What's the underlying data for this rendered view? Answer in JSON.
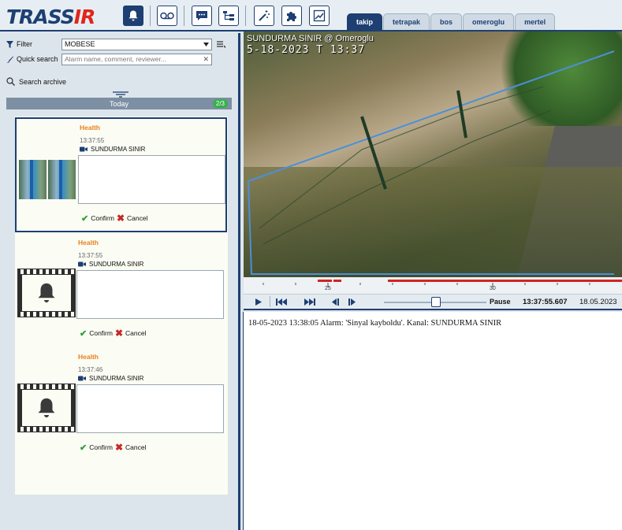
{
  "app": {
    "logo_main": "TRASS",
    "logo_accent": "IR"
  },
  "toolbar": {
    "tools": [
      "bell-icon",
      "voicemail-icon",
      "chat-icon",
      "tree-icon",
      "magic-wand-icon",
      "puzzle-icon",
      "chart-edit-icon"
    ]
  },
  "tabs": [
    {
      "label": "takip",
      "active": true
    },
    {
      "label": "tetrapak",
      "active": false
    },
    {
      "label": "bos",
      "active": false
    },
    {
      "label": "omeroglu",
      "active": false
    },
    {
      "label": "mertel",
      "active": false
    }
  ],
  "left": {
    "filter_label": "Filter",
    "filter_value": "MOBESE",
    "quick_search_label": "Quick search",
    "quick_search_placeholder": "Alarm name, comment, reviewer...",
    "search_archive_label": "Search archive",
    "today_label": "Today",
    "today_count": "2/3"
  },
  "alarms": [
    {
      "type": "Health",
      "time": "13:37:55",
      "channel": "SUNDURMA SINIR",
      "confirm": "Confirm",
      "cancel": "Cancel",
      "thumbnail": "camera-snapshot"
    },
    {
      "type": "Health",
      "time": "13:37:55",
      "channel": "SUNDURMA SINIR",
      "confirm": "Confirm",
      "cancel": "Cancel",
      "thumbnail": "bell-film-icon"
    },
    {
      "type": "Health",
      "time": "13:37:46",
      "channel": "SUNDURMA SINIR",
      "confirm": "Confirm",
      "cancel": "Cancel",
      "thumbnail": "bell-film-icon"
    }
  ],
  "video": {
    "osd_title": "SUNDURMA SINIR @ Omeroglu",
    "osd_time": "5-18-2023 T   13:37"
  },
  "timeline": {
    "tick_labels": [
      "25",
      "30"
    ]
  },
  "player": {
    "state": "Pause",
    "time": "13:37:55.607",
    "date": "18.05.2023"
  },
  "log": {
    "lines": [
      "18-05-2023 13:38:05 Alarm: 'Sinyal kayboldu'. Kanal: SUNDURMA SINIR"
    ]
  },
  "colors": {
    "brand_navy": "#1d3f72",
    "brand_red": "#e0261b",
    "alarm_orange": "#e8821e",
    "confirm_green": "#2e9e3b",
    "cancel_red": "#c62828",
    "timeline_red": "#d32222"
  }
}
